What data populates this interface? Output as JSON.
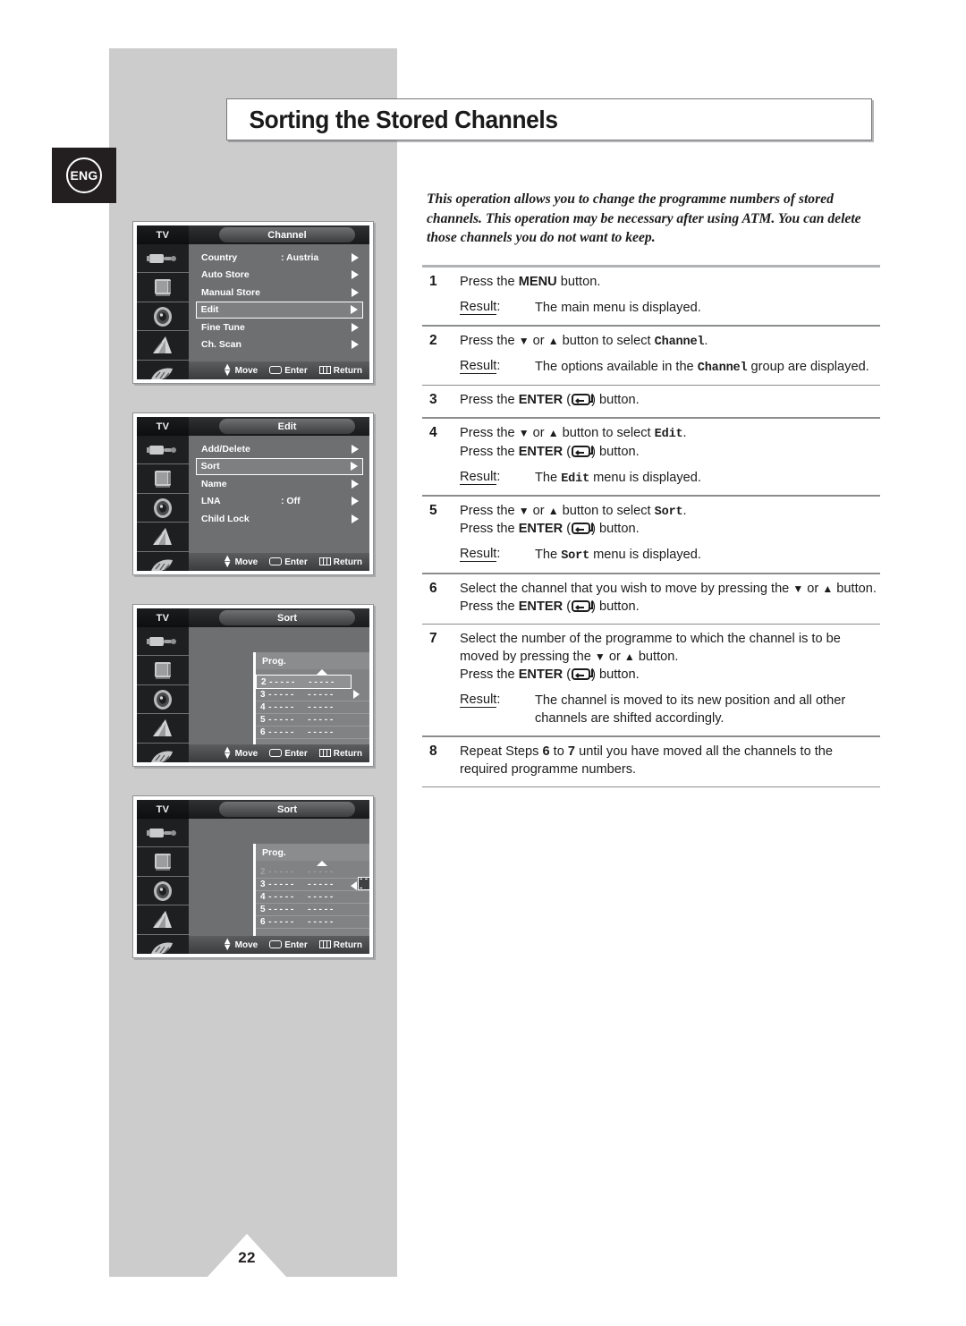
{
  "page": {
    "number": "22",
    "language_badge": "ENG",
    "title": "Sorting the Stored Channels",
    "intro": "This operation allows you to change the programme numbers of stored channels. This operation may be necessary after using ATM. You can delete those channels you do not want to keep."
  },
  "labels": {
    "result": "Result:",
    "move": "Move",
    "enter": "Enter",
    "return": "Return",
    "tv": "TV"
  },
  "steps": [
    {
      "num": "1",
      "lines": [
        [
          {
            "t": "Press the "
          },
          {
            "t": "MENU",
            "s": "b"
          },
          {
            "t": " button."
          }
        ]
      ],
      "result": [
        {
          "t": "The main menu is displayed."
        }
      ]
    },
    {
      "num": "2",
      "lines": [
        [
          {
            "t": "Press the "
          },
          {
            "t": "▼",
            "s": "g"
          },
          {
            "t": " or "
          },
          {
            "t": "▲",
            "s": "g"
          },
          {
            "t": " button to select "
          },
          {
            "t": "Channel",
            "s": "m"
          },
          {
            "t": "."
          }
        ]
      ],
      "result": [
        {
          "t": "The options available in the "
        },
        {
          "t": "Channel",
          "s": "m"
        },
        {
          "t": " group are displayed."
        }
      ]
    },
    {
      "num": "3",
      "lines": [
        [
          {
            "t": "Press the "
          },
          {
            "t": "ENTER",
            "s": "b"
          },
          {
            "t": " ("
          },
          {
            "t": "",
            "s": "k"
          },
          {
            "t": ") button."
          }
        ]
      ],
      "result": null
    },
    {
      "num": "4",
      "lines": [
        [
          {
            "t": "Press the "
          },
          {
            "t": "▼",
            "s": "g"
          },
          {
            "t": " or "
          },
          {
            "t": "▲",
            "s": "g"
          },
          {
            "t": " button to select "
          },
          {
            "t": "Edit",
            "s": "m"
          },
          {
            "t": "."
          }
        ],
        [
          {
            "t": "Press the "
          },
          {
            "t": "ENTER",
            "s": "b"
          },
          {
            "t": " ("
          },
          {
            "t": "",
            "s": "k"
          },
          {
            "t": ") button."
          }
        ]
      ],
      "result": [
        {
          "t": "The "
        },
        {
          "t": "Edit",
          "s": "m"
        },
        {
          "t": " menu is displayed."
        }
      ]
    },
    {
      "num": "5",
      "lines": [
        [
          {
            "t": "Press the "
          },
          {
            "t": "▼",
            "s": "g"
          },
          {
            "t": " or "
          },
          {
            "t": "▲",
            "s": "g"
          },
          {
            "t": " button to select "
          },
          {
            "t": "Sort",
            "s": "m"
          },
          {
            "t": "."
          }
        ],
        [
          {
            "t": "Press the "
          },
          {
            "t": "ENTER",
            "s": "b"
          },
          {
            "t": " ("
          },
          {
            "t": "",
            "s": "k"
          },
          {
            "t": ") button."
          }
        ]
      ],
      "result": [
        {
          "t": "The "
        },
        {
          "t": "Sort",
          "s": "m"
        },
        {
          "t": " menu is displayed."
        }
      ]
    },
    {
      "num": "6",
      "lines": [
        [
          {
            "t": "Select the channel that you wish to move by pressing the "
          },
          {
            "t": "▼",
            "s": "g"
          },
          {
            "t": " or "
          },
          {
            "t": "▲",
            "s": "g"
          },
          {
            "t": " button. Press the "
          },
          {
            "t": "ENTER",
            "s": "b"
          },
          {
            "t": " ("
          },
          {
            "t": "",
            "s": "k"
          },
          {
            "t": ") button."
          }
        ]
      ],
      "result": null
    },
    {
      "num": "7",
      "lines": [
        [
          {
            "t": "Select the number of the programme to which the channel is to be moved by pressing the "
          },
          {
            "t": "▼",
            "s": "g"
          },
          {
            "t": " or "
          },
          {
            "t": "▲",
            "s": "g"
          },
          {
            "t": " button."
          }
        ],
        [
          {
            "t": "Press the "
          },
          {
            "t": "ENTER",
            "s": "b"
          },
          {
            "t": " ("
          },
          {
            "t": "",
            "s": "k"
          },
          {
            "t": ") button."
          }
        ]
      ],
      "result": [
        {
          "t": "The channel is moved to its new position and all other channels are shifted accordingly."
        }
      ]
    },
    {
      "num": "8",
      "lines": [
        [
          {
            "t": "Repeat Steps "
          },
          {
            "t": "6",
            "s": "b"
          },
          {
            "t": " to "
          },
          {
            "t": "7",
            "s": "b"
          },
          {
            "t": " until you have moved all the channels to the required programme numbers."
          }
        ]
      ],
      "result": null
    }
  ],
  "osd_screens": [
    {
      "id": "channel",
      "title": "Channel",
      "type": "list",
      "rows": [
        {
          "label": "Country",
          "value": ": Austria",
          "arrow": true,
          "selected": false
        },
        {
          "label": "Auto Store",
          "value": "",
          "arrow": true,
          "selected": false
        },
        {
          "label": "Manual Store",
          "value": "",
          "arrow": true,
          "selected": false
        },
        {
          "label": "Edit",
          "value": "",
          "arrow": true,
          "selected": true
        },
        {
          "label": "Fine Tune",
          "value": "",
          "arrow": true,
          "selected": false
        },
        {
          "label": "Ch. Scan",
          "value": "",
          "arrow": true,
          "selected": false
        }
      ]
    },
    {
      "id": "edit",
      "title": "Edit",
      "type": "list",
      "rows": [
        {
          "label": "Add/Delete",
          "value": "",
          "arrow": true,
          "selected": false
        },
        {
          "label": "Sort",
          "value": "",
          "arrow": true,
          "selected": true
        },
        {
          "label": "Name",
          "value": "",
          "arrow": true,
          "selected": false
        },
        {
          "label": "LNA",
          "value": ": Off",
          "arrow": true,
          "selected": false
        },
        {
          "label": "Child Lock",
          "value": "",
          "arrow": true,
          "selected": false
        }
      ]
    },
    {
      "id": "sort-select",
      "title": "Sort",
      "type": "sort",
      "column_header": "Prog.",
      "mode": "select",
      "rows": [
        {
          "n": "2",
          "c1": "-----",
          "c2": "-----",
          "highlight": true,
          "dim": false
        },
        {
          "n": "3",
          "c1": "-----",
          "c2": "-----",
          "highlight": false,
          "dim": false
        },
        {
          "n": "4",
          "c1": "-----",
          "c2": "-----",
          "highlight": false,
          "dim": false
        },
        {
          "n": "5",
          "c1": "-----",
          "c2": "-----",
          "highlight": false,
          "dim": false
        },
        {
          "n": "6",
          "c1": "-----",
          "c2": "-----",
          "highlight": false,
          "dim": false
        }
      ],
      "move_box": ""
    },
    {
      "id": "sort-move",
      "title": "Sort",
      "type": "sort",
      "column_header": "Prog.",
      "mode": "move",
      "rows": [
        {
          "n": "2",
          "c1": "-----",
          "c2": "-----",
          "highlight": false,
          "dim": true
        },
        {
          "n": "3",
          "c1": "-----",
          "c2": "-----",
          "highlight": false,
          "dim": false
        },
        {
          "n": "4",
          "c1": "-----",
          "c2": "-----",
          "highlight": false,
          "dim": false
        },
        {
          "n": "5",
          "c1": "-----",
          "c2": "-----",
          "highlight": false,
          "dim": false
        },
        {
          "n": "6",
          "c1": "-----",
          "c2": "-----",
          "highlight": false,
          "dim": false
        }
      ],
      "move_box": "----- -----"
    }
  ],
  "colors": {
    "page_grey": "#cccccc",
    "osd_grey": "#6d6f71",
    "ink": "#1c1c1c",
    "badge_black": "#231f20"
  }
}
